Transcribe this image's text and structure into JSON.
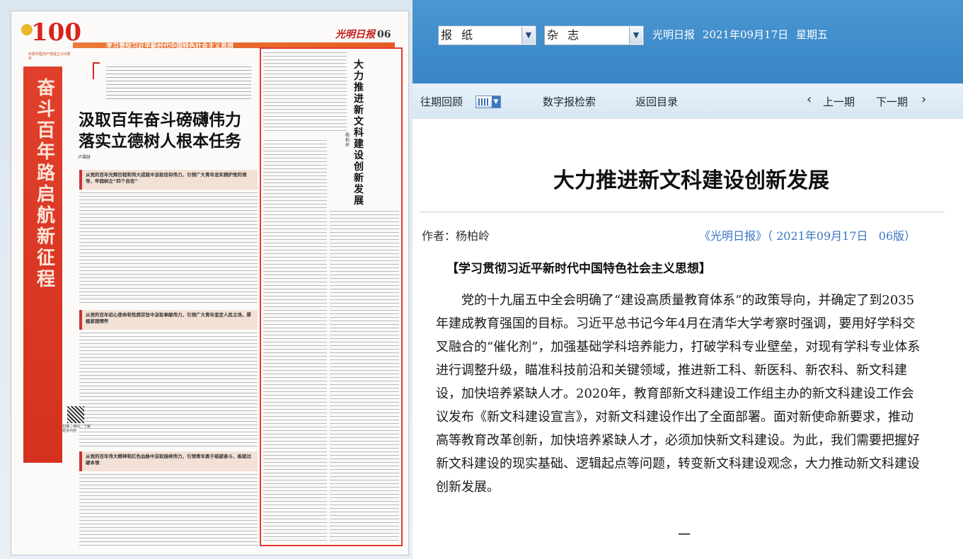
{
  "top": {
    "select_type": "报 纸",
    "select_magazine": "杂 志",
    "paper_name": "光明日报",
    "date": "2021年09月17日",
    "weekday": "星期五"
  },
  "nav": {
    "archive": "往期回顾",
    "search": "数字报检索",
    "back": "返回目录",
    "prev": "上一期",
    "next": "下一期",
    "prev_arrow": "‹",
    "next_arrow": "›"
  },
  "newspaper": {
    "logo_number": "100",
    "logo_caption": "庆祝中国共产党成立100周年",
    "vertical_slogan": "奋斗百年路 启航新征程",
    "page_header": "学习贯彻习近平新时代中国特色社会主义思想",
    "masthead": "光明日报",
    "page_number": "06",
    "main_title": "汲取百年奋斗磅礴伟力 落实立德树人根本任务",
    "main_author": "卢福财",
    "sub1": "从党的百年光辉历程和伟大成就中汲取信仰伟力，引领广大青年忠实拥护党的领导，牢固树立“四个自信”",
    "sub2": "从党的百年初心使命和性质宗旨中汲取奉献伟力，引领广大青年坚定人民立场，厚植家国情怀",
    "sub3": "从党的百年伟大精神和红色血脉中汲取接续伟力，引领青年勇于砥砺奋斗，练就过硬本领",
    "vertical_title": "大力推进新文科建设创新发展",
    "vertical_author": "杨柏岭",
    "qr_caption": "扫描二维码，了解更多内容"
  },
  "article": {
    "title": "大力推进新文科建设创新发展",
    "author": "作者：杨柏岭",
    "source": "《光明日报》（ 2021年09月17日   06版）",
    "column": "【学习贯彻习近平新时代中国特色社会主义思想】",
    "paragraph": "党的十九届五中全会明确了“建设高质量教育体系”的政策导向，并确定了到2035年建成教育强国的目标。习近平总书记今年4月在清华大学考察时强调，要用好学科交叉融合的“催化剂”，加强基础学科培养能力，打破学科专业壁垒，对现有学科专业体系进行调整升级，瞄准科技前沿和关键领域，推进新工科、新医科、新农科、新文科建设，加快培养紧缺人才。2020年，教育部新文科建设工作组主办的新文科建设工作会议发布《新文科建设宣言》，对新文科建设作出了全面部署。面对新使命新要求，推动高等教育改革创新，加快培养紧缺人才，必须加快新文科建设。为此，我们需要把握好新文科建设的现实基础、逻辑起点等问题，转变新文科建设观念，大力推动新文科建设创新发展。",
    "section_marker": "一"
  }
}
